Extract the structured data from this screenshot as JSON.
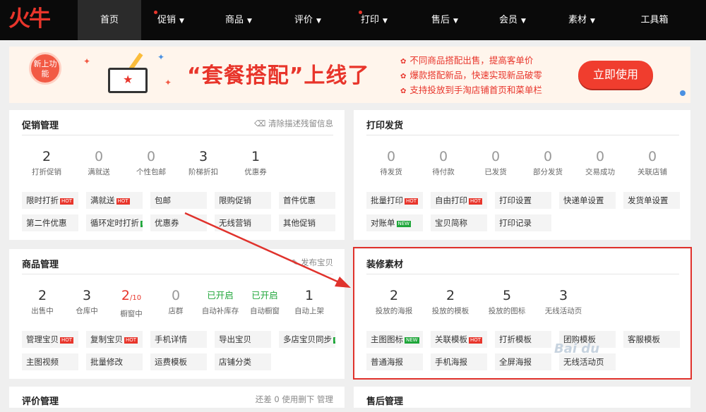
{
  "nav": {
    "logo": "火牛",
    "items": [
      {
        "label": "首页",
        "dropdown": false,
        "dot": false,
        "active": true
      },
      {
        "label": "促销",
        "dropdown": true,
        "dot": true,
        "active": false
      },
      {
        "label": "商品",
        "dropdown": true,
        "dot": false,
        "active": false
      },
      {
        "label": "评价",
        "dropdown": true,
        "dot": false,
        "active": false
      },
      {
        "label": "打印",
        "dropdown": true,
        "dot": true,
        "active": false
      },
      {
        "label": "售后",
        "dropdown": true,
        "dot": false,
        "active": false
      },
      {
        "label": "会员",
        "dropdown": true,
        "dot": false,
        "active": false
      },
      {
        "label": "素材",
        "dropdown": true,
        "dot": false,
        "active": false
      },
      {
        "label": "工具箱",
        "dropdown": false,
        "dot": false,
        "active": false
      }
    ]
  },
  "banner": {
    "badge": "新上功能",
    "title": "“套餐搭配”上线了",
    "bullets": [
      "不同商品搭配出售，提高客单价",
      "爆款搭配新品，快速实现新品破零",
      "支持投放到手淘店铺首页和菜单栏"
    ],
    "cta": "立即使用"
  },
  "promo": {
    "title": "促销管理",
    "link": "清除描述残留信息",
    "stats": [
      {
        "value": "2",
        "label": "打折促销"
      },
      {
        "value": "0",
        "label": "满就送"
      },
      {
        "value": "0",
        "label": "个性包邮"
      },
      {
        "value": "3",
        "label": "阶梯折扣"
      },
      {
        "value": "1",
        "label": "优惠券"
      }
    ],
    "buttons": [
      {
        "label": "限时打折",
        "tag": "HOT"
      },
      {
        "label": "满就送",
        "tag": "HOT"
      },
      {
        "label": "包邮",
        "tag": ""
      },
      {
        "label": "限购促销",
        "tag": ""
      },
      {
        "label": "首件优惠",
        "tag": ""
      },
      {
        "label": "第二件优惠",
        "tag": ""
      },
      {
        "label": "循环定时打折",
        "tag": "NEW"
      },
      {
        "label": "优惠券",
        "tag": ""
      },
      {
        "label": "无线营销",
        "tag": ""
      },
      {
        "label": "其他促销",
        "tag": ""
      }
    ]
  },
  "print": {
    "title": "打印发货",
    "stats": [
      {
        "value": "0",
        "label": "待发货"
      },
      {
        "value": "0",
        "label": "待付款"
      },
      {
        "value": "0",
        "label": "已发货"
      },
      {
        "value": "0",
        "label": "部分发货"
      },
      {
        "value": "0",
        "label": "交易成功"
      },
      {
        "value": "0",
        "label": "关联店铺"
      }
    ],
    "buttons": [
      {
        "label": "批量打印",
        "tag": "HOT"
      },
      {
        "label": "自由打印",
        "tag": "HOT"
      },
      {
        "label": "打印设置",
        "tag": ""
      },
      {
        "label": "快递单设置",
        "tag": ""
      },
      {
        "label": "发货单设置",
        "tag": ""
      },
      {
        "label": "对账单",
        "tag": "NEW"
      },
      {
        "label": "宝贝简称",
        "tag": ""
      },
      {
        "label": "打印记录",
        "tag": ""
      }
    ]
  },
  "goods": {
    "title": "商品管理",
    "link": "发布宝贝",
    "stats": [
      {
        "value": "2",
        "label": "出售中",
        "style": ""
      },
      {
        "value": "3",
        "label": "仓库中",
        "style": ""
      },
      {
        "value": "2",
        "suffix": "/10",
        "label": "橱窗中",
        "style": "red"
      },
      {
        "value": "0",
        "label": "店群",
        "style": "zero"
      },
      {
        "value": "已开启",
        "label": "自动补库存",
        "style": "green"
      },
      {
        "value": "已开启",
        "label": "自动橱窗",
        "style": "green"
      },
      {
        "value": "1",
        "label": "自动上架",
        "style": ""
      }
    ],
    "buttons": [
      {
        "label": "管理宝贝",
        "tag": "HOT"
      },
      {
        "label": "复制宝贝",
        "tag": "HOT"
      },
      {
        "label": "手机详情",
        "tag": ""
      },
      {
        "label": "导出宝贝",
        "tag": ""
      },
      {
        "label": "多店宝贝同步",
        "tag": "NEW"
      },
      {
        "label": "主图视频",
        "tag": ""
      },
      {
        "label": "批量修改",
        "tag": ""
      },
      {
        "label": "运费模板",
        "tag": ""
      },
      {
        "label": "店铺分类",
        "tag": ""
      }
    ]
  },
  "decor": {
    "title": "装修素材",
    "stats": [
      {
        "value": "2",
        "label": "投放的海报"
      },
      {
        "value": "2",
        "label": "投放的模板"
      },
      {
        "value": "5",
        "label": "投放的图标"
      },
      {
        "value": "3",
        "label": "无线活动页"
      }
    ],
    "buttons": [
      {
        "label": "主图图标",
        "tag": "NEW"
      },
      {
        "label": "关联模板",
        "tag": "HOT"
      },
      {
        "label": "打折模板",
        "tag": ""
      },
      {
        "label": "团购模板",
        "tag": ""
      },
      {
        "label": "客服模板",
        "tag": ""
      },
      {
        "label": "普通海报",
        "tag": ""
      },
      {
        "label": "手机海报",
        "tag": ""
      },
      {
        "label": "全屏海报",
        "tag": ""
      },
      {
        "label": "无线活动页",
        "tag": ""
      }
    ]
  },
  "bottom": {
    "left_title": "评价管理",
    "left_link": "还差 0 使用删下 管理",
    "right_title": "售后管理"
  },
  "watermark": "Bai du",
  "colors": {
    "accent": "#e8352b",
    "green": "#1fa63a",
    "highlight": "#e0322c"
  }
}
